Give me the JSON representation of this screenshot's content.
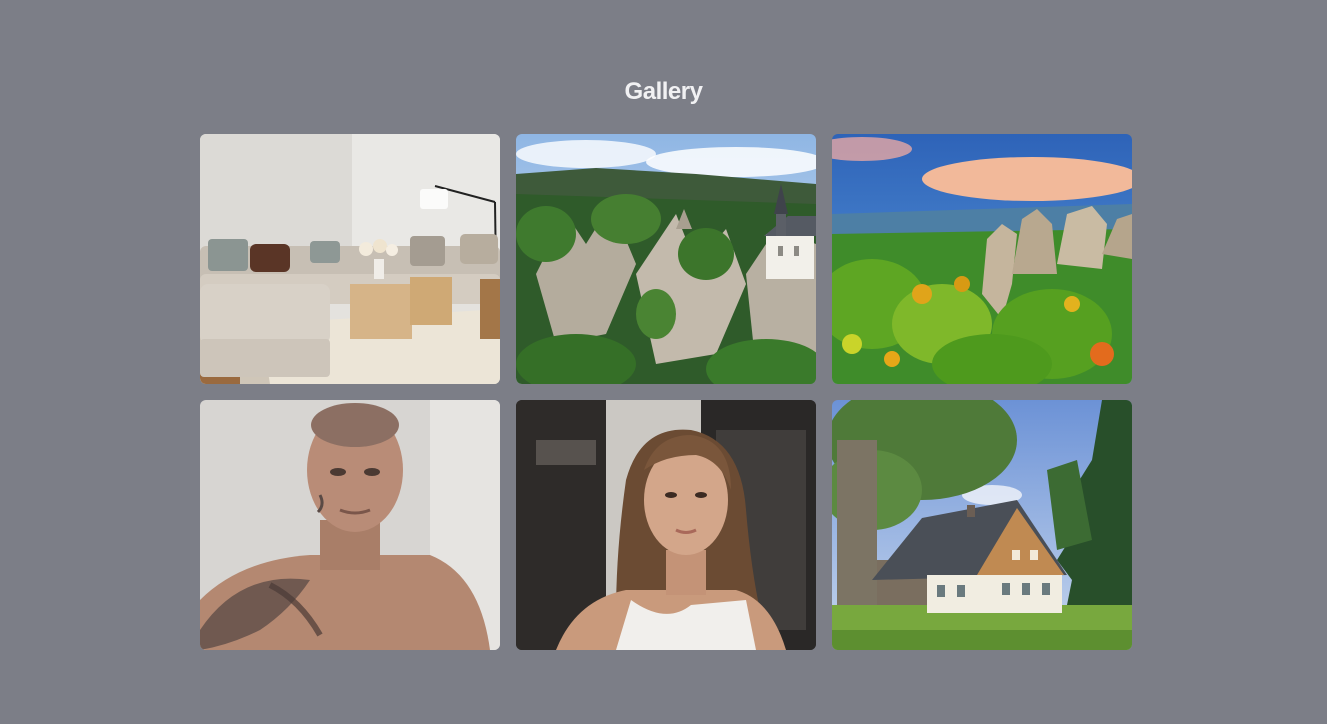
{
  "gallery": {
    "title": "Gallery",
    "images": [
      {
        "subject": "living-room-photo"
      },
      {
        "subject": "rock-chapel-photo"
      },
      {
        "subject": "sandstone-rocks-autumn-photo"
      },
      {
        "subject": "tattooed-man-portrait-photo"
      },
      {
        "subject": "woman-portrait-photo"
      },
      {
        "subject": "cottage-house-photo"
      }
    ]
  }
}
